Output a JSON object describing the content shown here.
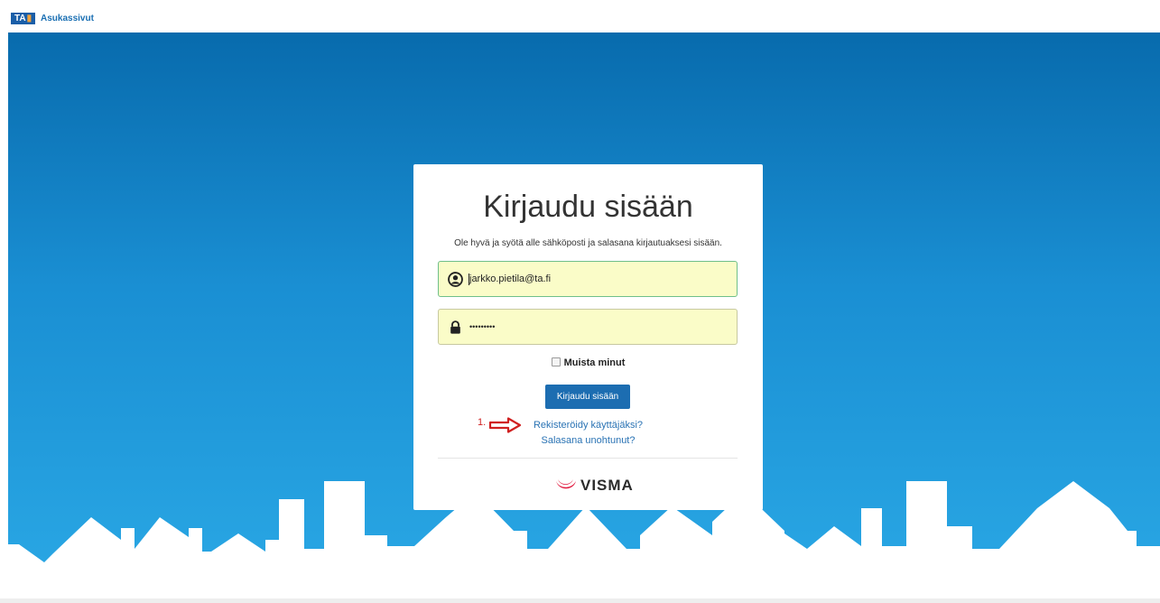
{
  "header": {
    "logo_text": "TA",
    "app_name": "Asukassivut"
  },
  "login": {
    "title": "Kirjaudu sisään",
    "instruction": "Ole hyvä ja syötä alle sähköposti ja salasana kirjautuaksesi sisään.",
    "email_value": "jarkko.pietila@ta.fi",
    "password_masked": "•••••••••",
    "remember_label": "Muista minut",
    "submit_label": "Kirjaudu sisään",
    "register_link": "Rekisteröidy käyttäjäksi?",
    "forgot_link": "Salasana unohtunut?",
    "footer_brand": "VISMA"
  },
  "annotation": {
    "number": "1."
  },
  "colors": {
    "accent": "#1c6db1",
    "link": "#2a73b4",
    "field_bg": "#fafcc8",
    "annotation_red": "#d02020",
    "visma_red": "#e0163b"
  },
  "icons": {
    "email": "user-circle-icon",
    "password": "lock-icon",
    "annotation": "arrow-right-icon"
  }
}
